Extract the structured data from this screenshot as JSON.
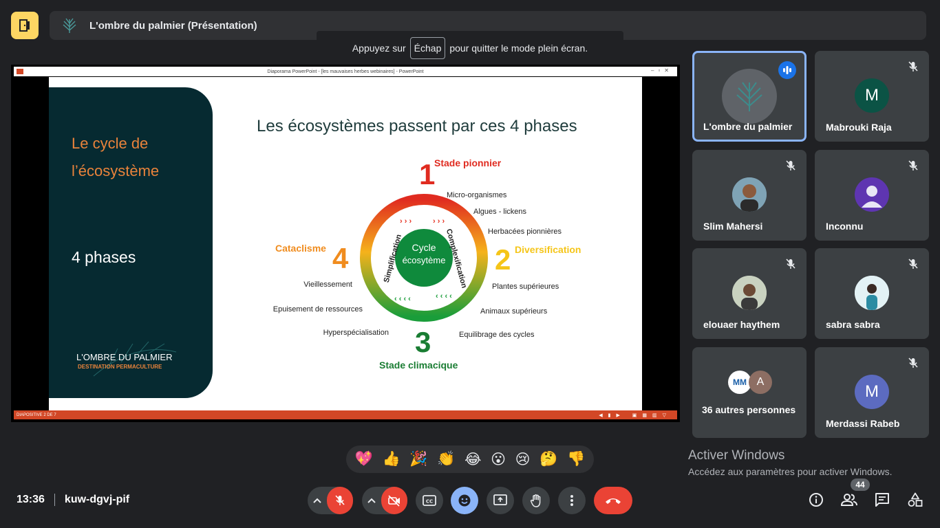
{
  "meeting": {
    "presentation_title": "L'ombre du palmier (Présentation)",
    "time": "13:36",
    "code": "kuw-dgvj-pif",
    "participant_count": "44"
  },
  "fullscreen_toast": {
    "before": "Appuyez sur",
    "key": "Échap",
    "after": "pour quitter le mode plein écran."
  },
  "powerpoint": {
    "window_title": "Diaporama PowerPoint - [les mauvaises herbes webinaires] - PowerPoint",
    "status": "DIAPOSITIVE 2 DE 7"
  },
  "slide": {
    "panel_title": "Le cycle de l’écosystème",
    "panel_subtitle": "4 phases",
    "brand_name": "L'OMBRE DU PALMIER",
    "brand_tagline": "DESTINATION PERMACULTURE",
    "heading": "Les écosystèmes passent par ces 4 phases",
    "center": [
      "Cycle",
      "écosytème"
    ],
    "ring_left": "Simplification",
    "ring_right": "Complexification",
    "phases": [
      {
        "num": "1",
        "label": "Stade pionnier",
        "color": "#e02b20"
      },
      {
        "num": "2",
        "label": "Diversification",
        "color": "#f5c518"
      },
      {
        "num": "3",
        "label": "Stade climacique",
        "color": "#1a7d33"
      },
      {
        "num": "4",
        "label": "Cataclisme",
        "color": "#f08c1e"
      }
    ],
    "notes_top": [
      "Micro-organismes",
      "Algues - lickens",
      "Herbacées pionnières"
    ],
    "notes_right": [
      "Plantes supérieures",
      "Animaux supérieurs",
      "Equilibrage des cycles"
    ],
    "notes_left": [
      "Vieillessement",
      "Epuisement de ressources",
      "Hyperspécialisation"
    ]
  },
  "participants": [
    {
      "name": "L'ombre du palmier",
      "type": "logo",
      "speaking": true
    },
    {
      "name": "Mabrouki Raja",
      "initial": "M",
      "color": "#0b5345"
    },
    {
      "name": "Slim Mahersi",
      "type": "photo"
    },
    {
      "name": "Inconnu",
      "type": "person",
      "color": "#5e35b1"
    },
    {
      "name": "elouaer haythem",
      "type": "photo"
    },
    {
      "name": "sabra sabra",
      "type": "photo"
    },
    {
      "name": "36 autres personnes",
      "type": "group",
      "initial": "A"
    },
    {
      "name": "Merdassi Rabeb",
      "initial": "M",
      "color": "#5c6bc0"
    }
  ],
  "reactions": [
    "💖",
    "👍",
    "🎉",
    "👏",
    "😂",
    "😮",
    "😢",
    "🤔",
    "👎"
  ],
  "windows_activation": {
    "title": "Activer Windows",
    "subtitle": "Accédez aux paramètres pour activer Windows."
  },
  "icons": {
    "exit": "exit-door-icon",
    "mic": "mic-off-icon",
    "camera": "camera-off-icon",
    "captions": "captions-icon",
    "emoji": "emoji-icon",
    "present": "present-screen-icon",
    "hand": "raise-hand-icon",
    "more": "more-vert-icon",
    "hangup": "hang-up-icon",
    "info": "info-icon",
    "people": "people-icon",
    "chat": "chat-icon",
    "activities": "activities-icon"
  },
  "colors": {
    "accent": "#8ab4f8",
    "danger": "#ea4335",
    "exit_bg": "#fdd663",
    "blue": "#1a73e8"
  }
}
